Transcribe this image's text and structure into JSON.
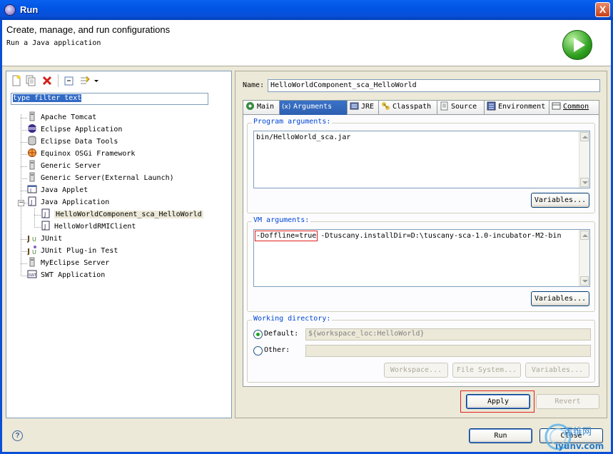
{
  "window": {
    "title": "Run",
    "close": "X"
  },
  "header": {
    "title": "Create, manage, and run configurations",
    "subtitle": "Run a Java application"
  },
  "filter": {
    "value": "type filter text"
  },
  "tree": [
    {
      "label": "Apache Tomcat",
      "icon": "tomcat-icon"
    },
    {
      "label": "Eclipse Application",
      "icon": "eclipse-icon"
    },
    {
      "label": "Eclipse Data Tools",
      "icon": "database-icon"
    },
    {
      "label": "Equinox OSGi Framework",
      "icon": "osgi-icon"
    },
    {
      "label": "Generic Server",
      "icon": "server-icon"
    },
    {
      "label": "Generic Server(External Launch)",
      "icon": "server-icon"
    },
    {
      "label": "Java Applet",
      "icon": "applet-icon"
    },
    {
      "label": "Java Application",
      "icon": "java-app-icon"
    },
    {
      "label": "HelloWorldComponent_sca_HelloWorld",
      "icon": "java-app-icon",
      "selected": true
    },
    {
      "label": "HelloWorldRMIClient",
      "icon": "java-app-icon"
    },
    {
      "label": "JUnit",
      "icon": "junit-icon"
    },
    {
      "label": "JUnit Plug-in Test",
      "icon": "junit-plugin-icon"
    },
    {
      "label": "MyEclipse Server",
      "icon": "server-icon"
    },
    {
      "label": "SWT Application",
      "icon": "swt-icon"
    }
  ],
  "name": {
    "label": "Name:",
    "value": "HelloWorldComponent_sca_HelloWorld"
  },
  "tabs": [
    {
      "label": "Main"
    },
    {
      "label": "Arguments"
    },
    {
      "label": "JRE"
    },
    {
      "label": "Classpath"
    },
    {
      "label": "Source"
    },
    {
      "label": "Environment"
    },
    {
      "label": "Common"
    }
  ],
  "program_args": {
    "label": "Program arguments:",
    "value": "bin/HelloWorld_sca.jar",
    "variables": "Variables..."
  },
  "vm_args": {
    "label": "VM arguments:",
    "highlighted": "-Doffline=true",
    "rest": " -Dtuscany.installDir=D:\\tuscany-sca-1.0-incubator-M2-bin",
    "variables": "Variables..."
  },
  "working_dir": {
    "label": "Working directory:",
    "default_label": "Default:",
    "default_value": "${workspace_loc:HelloWorld}",
    "other_label": "Other:",
    "workspace": "Workspace...",
    "filesystem": "File System...",
    "variables": "Variables..."
  },
  "actions": {
    "apply": "Apply",
    "revert": "Revert",
    "run": "Run",
    "close": "Close"
  },
  "watermark": {
    "cn": "运维网",
    "url": "iyunv.com"
  },
  "colors": {
    "accent": "#0054e3",
    "highlight": "#e02020"
  }
}
